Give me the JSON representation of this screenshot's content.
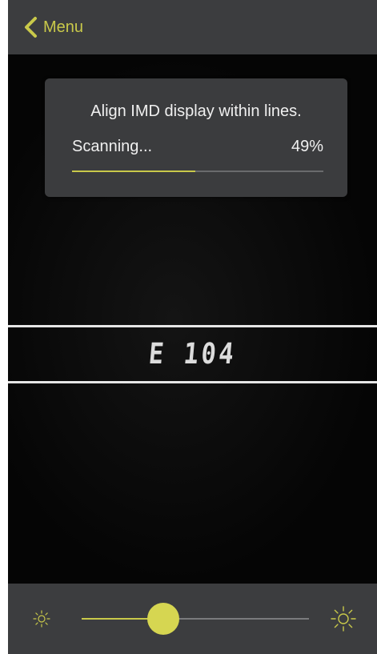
{
  "nav": {
    "back_label": "Menu",
    "back_icon": "chevron-left-icon"
  },
  "scan": {
    "instruction": "Align IMD display within lines.",
    "status": "Scanning...",
    "percent_label": "49%",
    "progress": 0.49
  },
  "camera": {
    "readout": "E 104"
  },
  "brightness": {
    "min_icon": "sun-small-icon",
    "max_icon": "sun-large-icon",
    "level": 0.36
  },
  "colors": {
    "accent": "#c9c94a",
    "bar_background": "#3c3d3f",
    "camera_background": "#060606"
  }
}
